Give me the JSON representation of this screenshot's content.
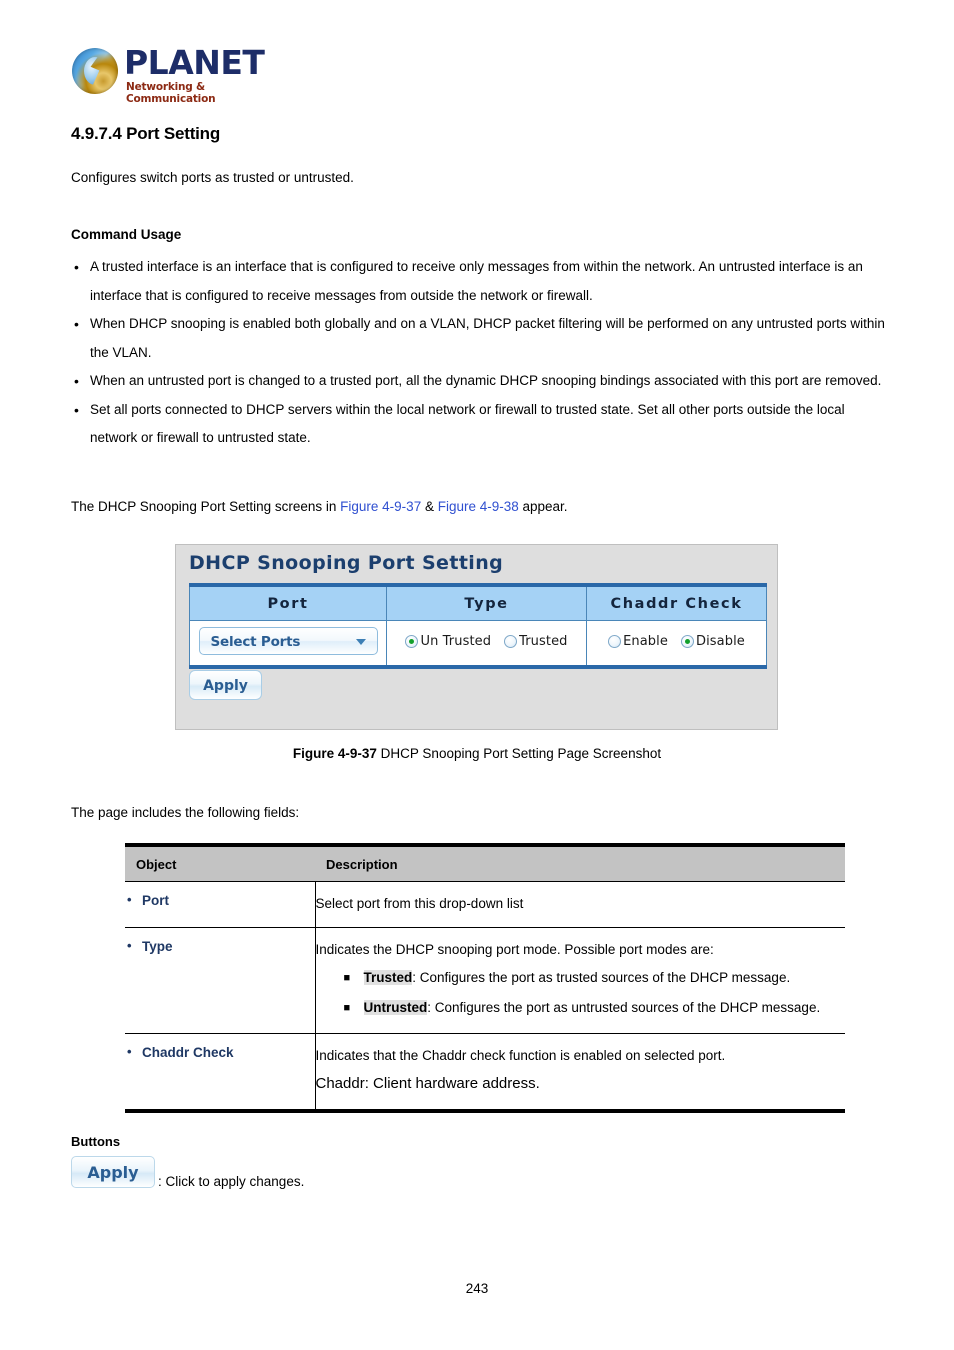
{
  "logo": {
    "wordmark": "PLANET",
    "tagline": "Networking & Communication"
  },
  "section": {
    "heading": "4.9.7.4 Port Setting",
    "intro": "Configures switch ports as trusted or untrusted.",
    "command_usage_heading": "Command Usage",
    "bullets": [
      "A trusted interface is an interface that is configured to receive only messages from within the network. An untrusted interface is an interface that is configured to receive messages from outside the network or firewall.",
      "When DHCP snooping is enabled both globally and on a VLAN, DHCP packet filtering will be performed on any untrusted ports within the VLAN.",
      "When an untrusted port is changed to a trusted port, all the dynamic DHCP snooping bindings associated with this port are removed.",
      "Set all ports connected to DHCP servers within the local network or firewall to trusted state. Set all other ports outside the local network or firewall to untrusted state."
    ],
    "screens_line": {
      "prefix": "The DHCP Snooping Port Setting screens in ",
      "ref1": "Figure 4-9-37",
      "mid": " & ",
      "ref2": "Figure 4-9-38",
      "suffix": " appear."
    },
    "fields_line": "The page includes the following fields:"
  },
  "figure": {
    "panel_title": "DHCP Snooping Port Setting",
    "headers": [
      "Port",
      "Type",
      "Chaddr Check"
    ],
    "port_select": {
      "value": "Select Ports",
      "caret": "chevron-down-icon"
    },
    "type_radios": [
      {
        "label": "Un Trusted",
        "checked": true
      },
      {
        "label": "Trusted",
        "checked": false
      }
    ],
    "chaddr_radios": [
      {
        "label": "Enable",
        "checked": false
      },
      {
        "label": "Disable",
        "checked": true
      }
    ],
    "apply_label": "Apply",
    "caption_bold": "Figure 4-9-37",
    "caption_rest": " DHCP Snooping Port Setting Page Screenshot"
  },
  "object_table": {
    "headers": {
      "object": "Object",
      "description": "Description"
    },
    "rows": [
      {
        "object": "Port",
        "desc_main": "Select port from this drop-down list",
        "sub_items": [],
        "desc_extra": ""
      },
      {
        "object": "Type",
        "desc_main": "Indicates the DHCP snooping port mode. Possible port modes are:",
        "sub_items": [
          {
            "term": "Trusted",
            "text": ": Configures the port as trusted sources of the DHCP message."
          },
          {
            "term": "Untrusted",
            "text": ": Configures the port as untrusted sources of the DHCP message."
          }
        ],
        "desc_extra": ""
      },
      {
        "object": "Chaddr Check",
        "desc_main": "Indicates that the Chaddr check function is enabled on selected port.",
        "sub_items": [],
        "desc_extra": "Chaddr: Client hardware address."
      }
    ]
  },
  "buttons_section": {
    "heading": "Buttons",
    "apply_label": "Apply",
    "apply_caption": ": Click to apply changes."
  },
  "footer": {
    "page_number": "243"
  },
  "colors": {
    "link_blue": "#2f4fd0",
    "object_blue": "#1f3864",
    "panel_title_blue": "#1c3f6e",
    "table_header_blue": "#a5d2f5",
    "table_border_blue": "#2a68a8",
    "radio_green": "#12a02c",
    "object_header_gray": "#c3c3c3"
  }
}
